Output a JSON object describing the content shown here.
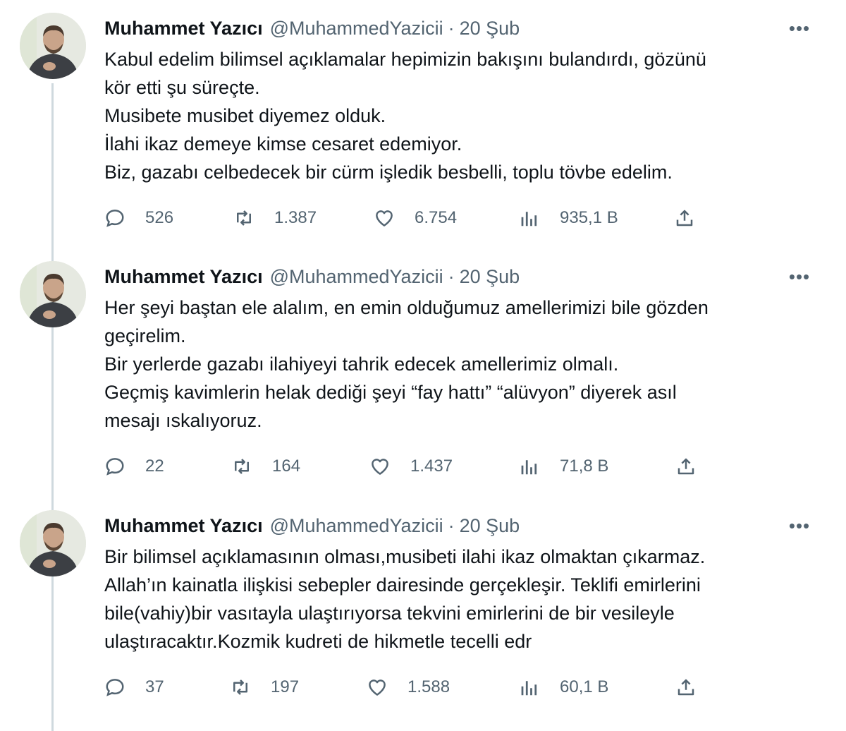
{
  "tweets": [
    {
      "name": "Muhammet Yazıcı",
      "handle": "@MuhammedYazicii",
      "separator": "·",
      "date": "20 Şub",
      "more": "•••",
      "lines": [
        "Kabul edelim bilimsel açıklamalar hepimizin bakışını bulandırdı, gözünü",
        "kör etti şu süreçte.",
        "Musibete musibet diyemez olduk.",
        "İlahi ikaz demeye kimse cesaret edemiyor.",
        "Biz, gazabı celbedecek bir cürm işledik besbelli, toplu tövbe edelim."
      ],
      "replies": "526",
      "retweets": "1.387",
      "likes": "6.754",
      "views": "935,1 B"
    },
    {
      "name": "Muhammet Yazıcı",
      "handle": "@MuhammedYazicii",
      "separator": "·",
      "date": "20 Şub",
      "more": "•••",
      "lines": [
        "Her şeyi baştan ele alalım, en emin olduğumuz amellerimizi bile gözden",
        "geçirelim.",
        "Bir yerlerde gazabı ilahiyeyi tahrik edecek amellerimiz olmalı.",
        "Geçmiş kavimlerin helak dediği şeyi “fay hattı” “alüvyon” diyerek asıl",
        "mesajı ıskalıyoruz."
      ],
      "replies": "22",
      "retweets": "164",
      "likes": "1.437",
      "views": "71,8 B"
    },
    {
      "name": "Muhammet Yazıcı",
      "handle": "@MuhammedYazicii",
      "separator": "·",
      "date": "20 Şub",
      "more": "•••",
      "lines": [
        "Bir bilimsel açıklamasının olması,musibeti ilahi ikaz olmaktan çıkarmaz.",
        "Allah’ın kainatla ilişkisi sebepler dairesinde gerçekleşir. Teklifi emirlerini",
        "bile(vahiy)bir vasıtayla ulaştırıyorsa tekvini emirlerini de bir vesileyle",
        "ulaştıracaktır.Kozmik kudreti de hikmetle tecelli edr"
      ],
      "replies": "37",
      "retweets": "197",
      "likes": "1.588",
      "views": "60,1 B"
    }
  ],
  "icons": {
    "reply": "reply-icon",
    "retweet": "retweet-icon",
    "like": "heart-icon",
    "views": "views-icon",
    "share": "share-icon",
    "more": "more-icon"
  },
  "colors": {
    "text": "#0f1419",
    "secondary": "#536471",
    "thread_line": "#cfd9de"
  }
}
